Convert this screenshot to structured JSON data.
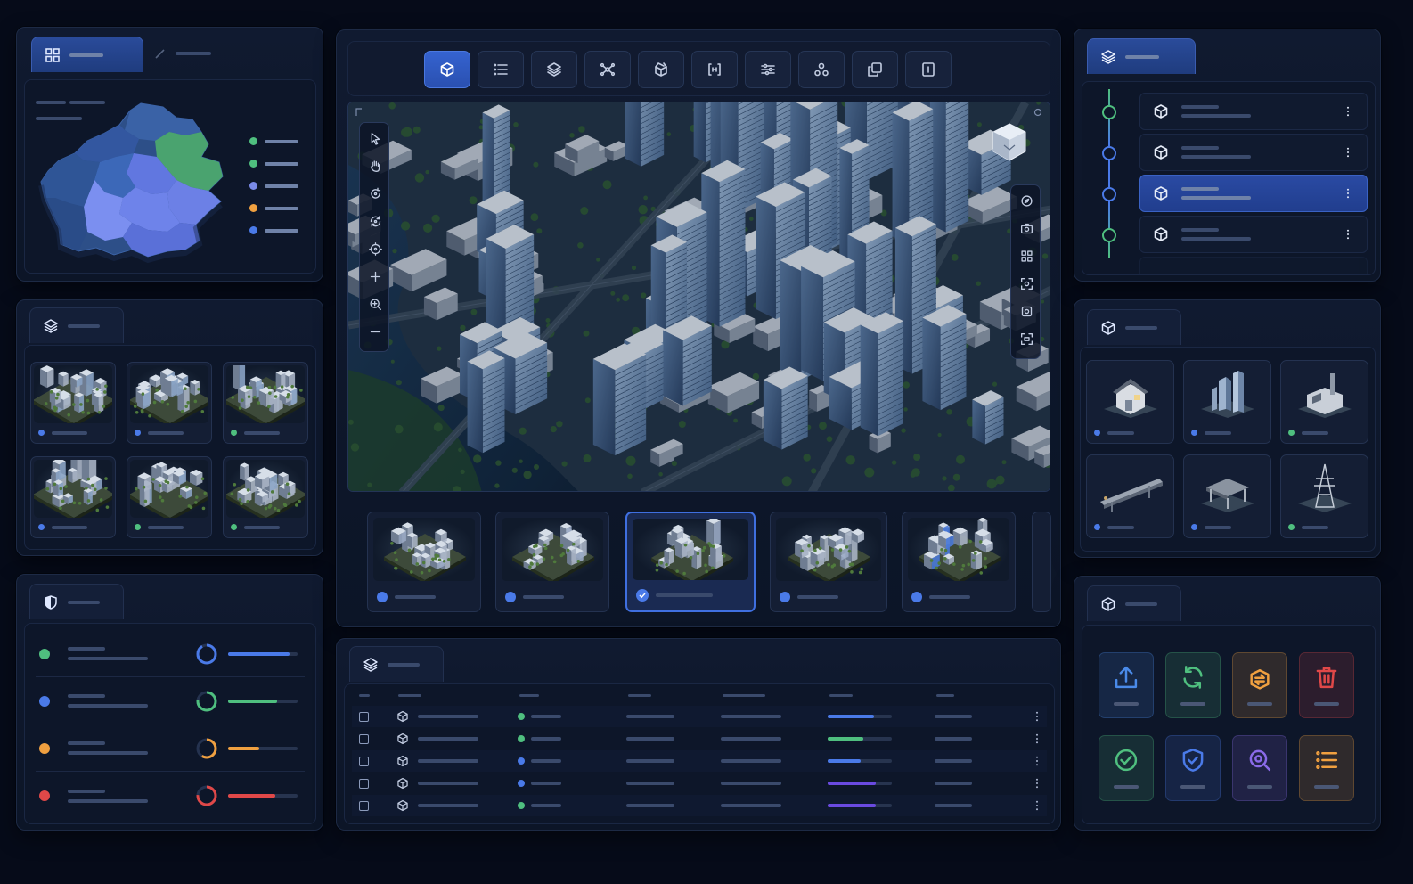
{
  "app": {
    "title": ""
  },
  "colors": {
    "accent": "#3563d0",
    "green": "#4fbf7f",
    "blue": "#4a7ae8",
    "orange": "#f0a040",
    "red": "#e04848",
    "purple": "#7a5ce8"
  },
  "map_panel": {
    "tabs": [
      {
        "icon": "grid-icon",
        "label": ""
      },
      {
        "icon": "pen-icon",
        "label": ""
      }
    ],
    "legend": [
      {
        "color": "#4fbf7f",
        "label": ""
      },
      {
        "color": "#4fbf7f",
        "label": ""
      },
      {
        "color": "#7a8ae8",
        "label": ""
      },
      {
        "color": "#f0a040",
        "label": ""
      },
      {
        "color": "#4a7ae8",
        "label": ""
      }
    ]
  },
  "scenes_panel": {
    "tab_icon": "layers-icon",
    "items": [
      {
        "status": "blue"
      },
      {
        "status": "blue"
      },
      {
        "status": "green"
      },
      {
        "status": "blue"
      },
      {
        "status": "green"
      },
      {
        "status": "green"
      }
    ]
  },
  "status_panel": {
    "tab_icon": "shield-icon",
    "rows": [
      {
        "dot": "#4fbf7f",
        "ring": "#4a7ae8",
        "bar": "#4a7ae8",
        "level": 0.88
      },
      {
        "dot": "#4a7ae8",
        "ring": "#4fbf7f",
        "bar": "#4fbf7f",
        "level": 0.7
      },
      {
        "dot": "#f0a040",
        "ring": "#f0a040",
        "bar": "#f0a040",
        "level": 0.45
      },
      {
        "dot": "#e04848",
        "ring": "#e04848",
        "bar": "#e04848",
        "level": 0.68
      }
    ]
  },
  "toolbar": {
    "buttons": [
      {
        "icon": "cube-icon",
        "active": true
      },
      {
        "icon": "list-icon"
      },
      {
        "icon": "layers-icon"
      },
      {
        "icon": "network-icon"
      },
      {
        "icon": "box-open-icon"
      },
      {
        "icon": "brackets-icon"
      },
      {
        "icon": "sliders-icon"
      },
      {
        "icon": "nodes-icon"
      },
      {
        "icon": "copy-icon"
      },
      {
        "icon": "panel-icon"
      }
    ]
  },
  "viewport": {
    "left_tools": [
      "pointer-icon",
      "hand-icon",
      "rotate-icon",
      "orbit-icon",
      "target-icon",
      "plus-icon",
      "zoom-in-icon",
      "minus-icon"
    ],
    "right_tools": [
      "compass-icon",
      "camera-icon",
      "grid-icon",
      "focus-icon",
      "capture-icon",
      "frame-icon"
    ],
    "view_cube_label": ""
  },
  "thumbnails": [
    {
      "status": "blue",
      "selected": false
    },
    {
      "status": "blue",
      "selected": false
    },
    {
      "status": "check",
      "selected": true
    },
    {
      "status": "blue",
      "selected": false
    },
    {
      "status": "blue",
      "selected": false
    }
  ],
  "tree_panel": {
    "tab_icon": "layers-icon",
    "items": [
      {
        "icon": "cube-icon",
        "selected": false,
        "node": "green"
      },
      {
        "icon": "cube-icon",
        "selected": false,
        "node": "blue"
      },
      {
        "icon": "cube-icon",
        "selected": true,
        "node": "blue"
      },
      {
        "icon": "cube-icon",
        "selected": false,
        "node": "green"
      }
    ]
  },
  "assets_panel": {
    "tab_icon": "cube-icon",
    "items": [
      {
        "name": "house",
        "status": "blue"
      },
      {
        "name": "towers",
        "status": "blue"
      },
      {
        "name": "factory",
        "status": "green"
      },
      {
        "name": "bridge",
        "status": "blue"
      },
      {
        "name": "pavilion",
        "status": "blue"
      },
      {
        "name": "power-tower",
        "status": "green"
      }
    ]
  },
  "table_panel": {
    "tab_icon": "layers-icon",
    "rows": [
      {
        "status": "#4fbf7f",
        "progress": 0.72,
        "bar": "#4a7ae8"
      },
      {
        "status": "#4fbf7f",
        "progress": 0.55,
        "bar": "#4fbf7f"
      },
      {
        "status": "#4a7ae8",
        "progress": 0.52,
        "bar": "#4a7ae8"
      },
      {
        "status": "#4a7ae8",
        "progress": 0.75,
        "bar": "#6a4ae0"
      },
      {
        "status": "#4fbf7f",
        "progress": 0.75,
        "bar": "#6a4ae0"
      }
    ]
  },
  "actions_panel": {
    "tab_icon": "cube-icon",
    "actions": [
      {
        "icon": "upload-icon",
        "color": "#4a8ae8"
      },
      {
        "icon": "refresh-icon",
        "color": "#4fbf7f"
      },
      {
        "icon": "transfer-icon",
        "color": "#f0a040"
      },
      {
        "icon": "trash-icon",
        "color": "#e04848"
      },
      {
        "icon": "check-circle-icon",
        "color": "#4fbf7f"
      },
      {
        "icon": "shield-check-icon",
        "color": "#4a7ae8"
      },
      {
        "icon": "search-icon",
        "color": "#8a6ae8"
      },
      {
        "icon": "list-icon",
        "color": "#f0a040"
      }
    ]
  }
}
